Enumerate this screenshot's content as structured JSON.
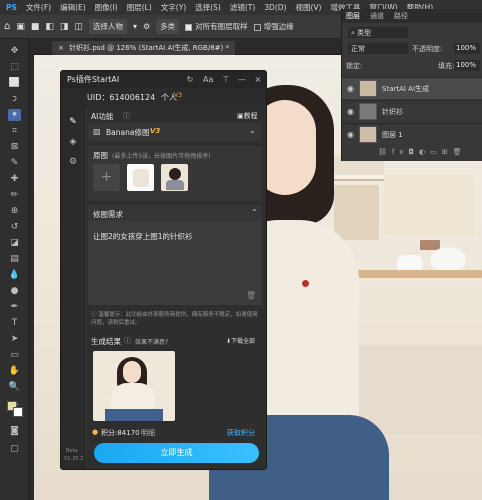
{
  "menubar": {
    "items": [
      "PS",
      "文件(F)",
      "编辑(E)",
      "图像(I)",
      "图层(L)",
      "文字(Y)",
      "选择(S)",
      "滤镜(T)",
      "3D(D)",
      "视图(V)",
      "增效工具",
      "窗口(W)",
      "帮助(H)"
    ]
  },
  "options": {
    "select_subject": "选择人物",
    "mode": "多类",
    "sample_all_layers": "对所有图层取样",
    "enhance_edge": "增强边缘"
  },
  "document": {
    "tab_title": "针织衫.psd @ 126% (StartAI AI生成, RGB/8#) *"
  },
  "plugin": {
    "title": "Ps插件StartAI",
    "uid": "UID：614006124",
    "account_type": "个人",
    "version_badge": "V3",
    "ai_function_label": "AI功能",
    "tutorial": "教程",
    "model_name": "Banana修图",
    "model_badge": "V3",
    "original_label": "原图",
    "original_hint": "(最多上传5张，长按图片可拖拽排序)",
    "edit_req_label": "修图需求",
    "prompt": "让图2的女孩穿上图1的针织衫",
    "warning": "温馨提示：此功能由外部服务商提供，偶有服务不稳定，如遇使用问题，请稍后重试。",
    "result_label": "生成结果",
    "feedback": "效果不满意?",
    "download_all": "下载全部",
    "points": "积分:84170",
    "recharge": "明细",
    "get_points": "获取积分",
    "generate_btn": "立即生成",
    "beta_label": "Beta",
    "version_small": "V1.35.2"
  },
  "layers": {
    "tabs": [
      "图层",
      "通道",
      "路径"
    ],
    "kind": "类型",
    "blend_mode": "正常",
    "opacity_label": "不透明度:",
    "opacity": "100%",
    "lock_label": "锁定:",
    "fill_label": "填充:",
    "fill": "100%",
    "rows": [
      {
        "name": "StartAI AI生成"
      },
      {
        "name": "针织衫"
      },
      {
        "name": "图层 1"
      }
    ]
  }
}
